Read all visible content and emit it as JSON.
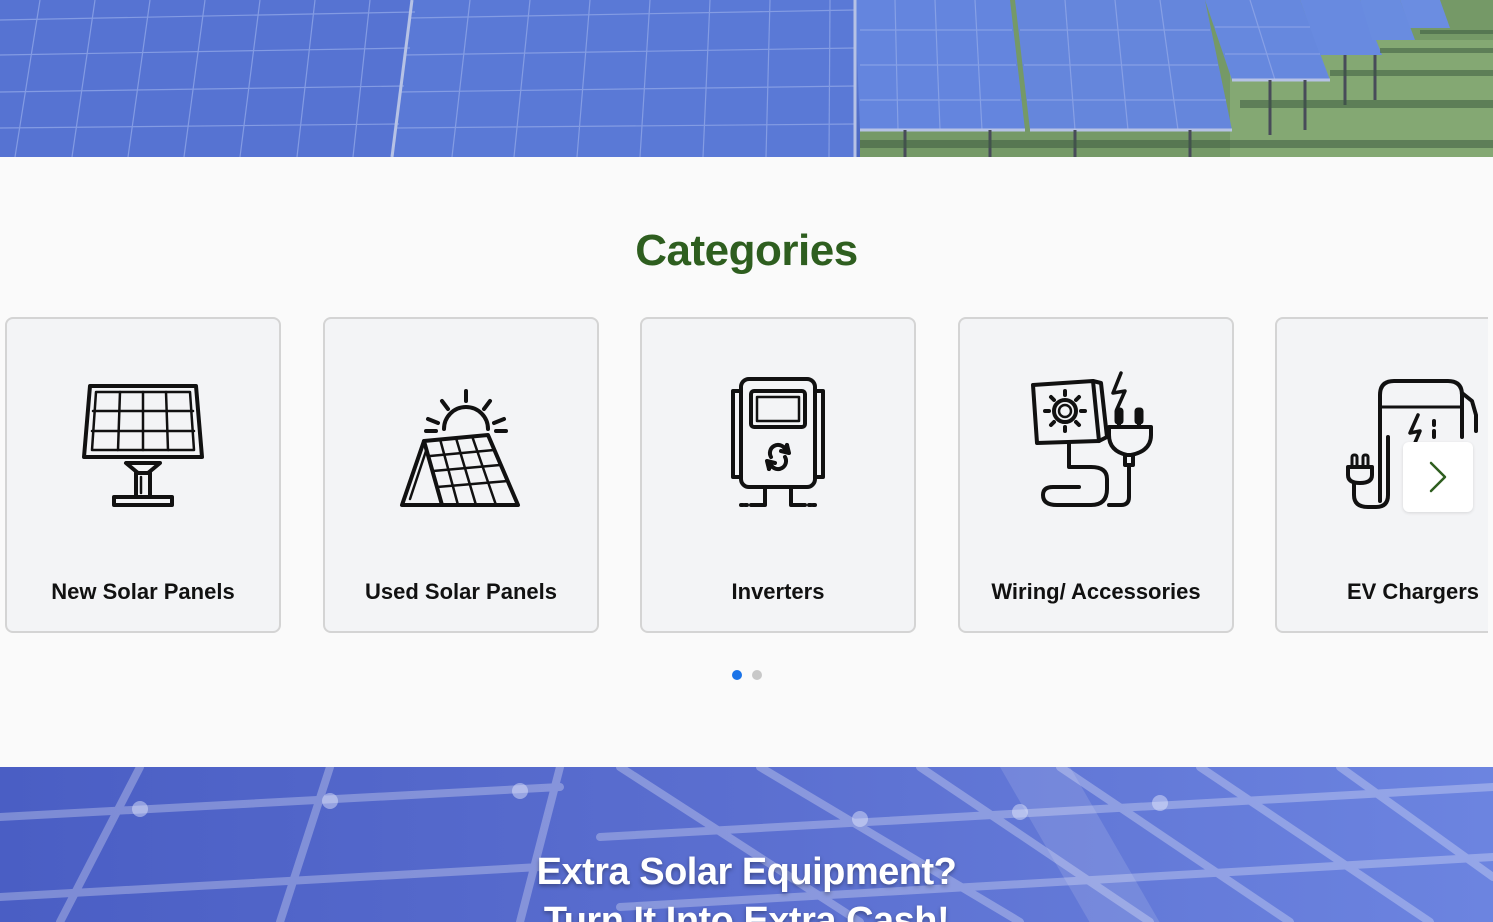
{
  "hero": {
    "image_alt": "Solar panels in a field"
  },
  "categories": {
    "title": "Categories",
    "items": [
      {
        "label": "New Solar Panels",
        "icon": "solar-panel-stand-icon"
      },
      {
        "label": "Used Solar Panels",
        "icon": "solar-panel-sun-icon"
      },
      {
        "label": "Inverters",
        "icon": "inverter-icon"
      },
      {
        "label": "Wiring/ Accessories",
        "icon": "plug-wiring-icon"
      },
      {
        "label": "EV Chargers",
        "icon": "ev-charger-icon"
      }
    ],
    "next_icon": "chevron-right-icon",
    "pagination": {
      "pages": 2,
      "active": 1
    }
  },
  "banner": {
    "headline_line1": "Extra Solar Equipment?",
    "headline_line2": "Turn It Into Extra Cash!"
  },
  "colors": {
    "title_green": "#2e5e1f",
    "dot_active": "#1a73e8",
    "dot_inactive": "#c8c8c8",
    "chevron_green": "#2e5e1f"
  }
}
